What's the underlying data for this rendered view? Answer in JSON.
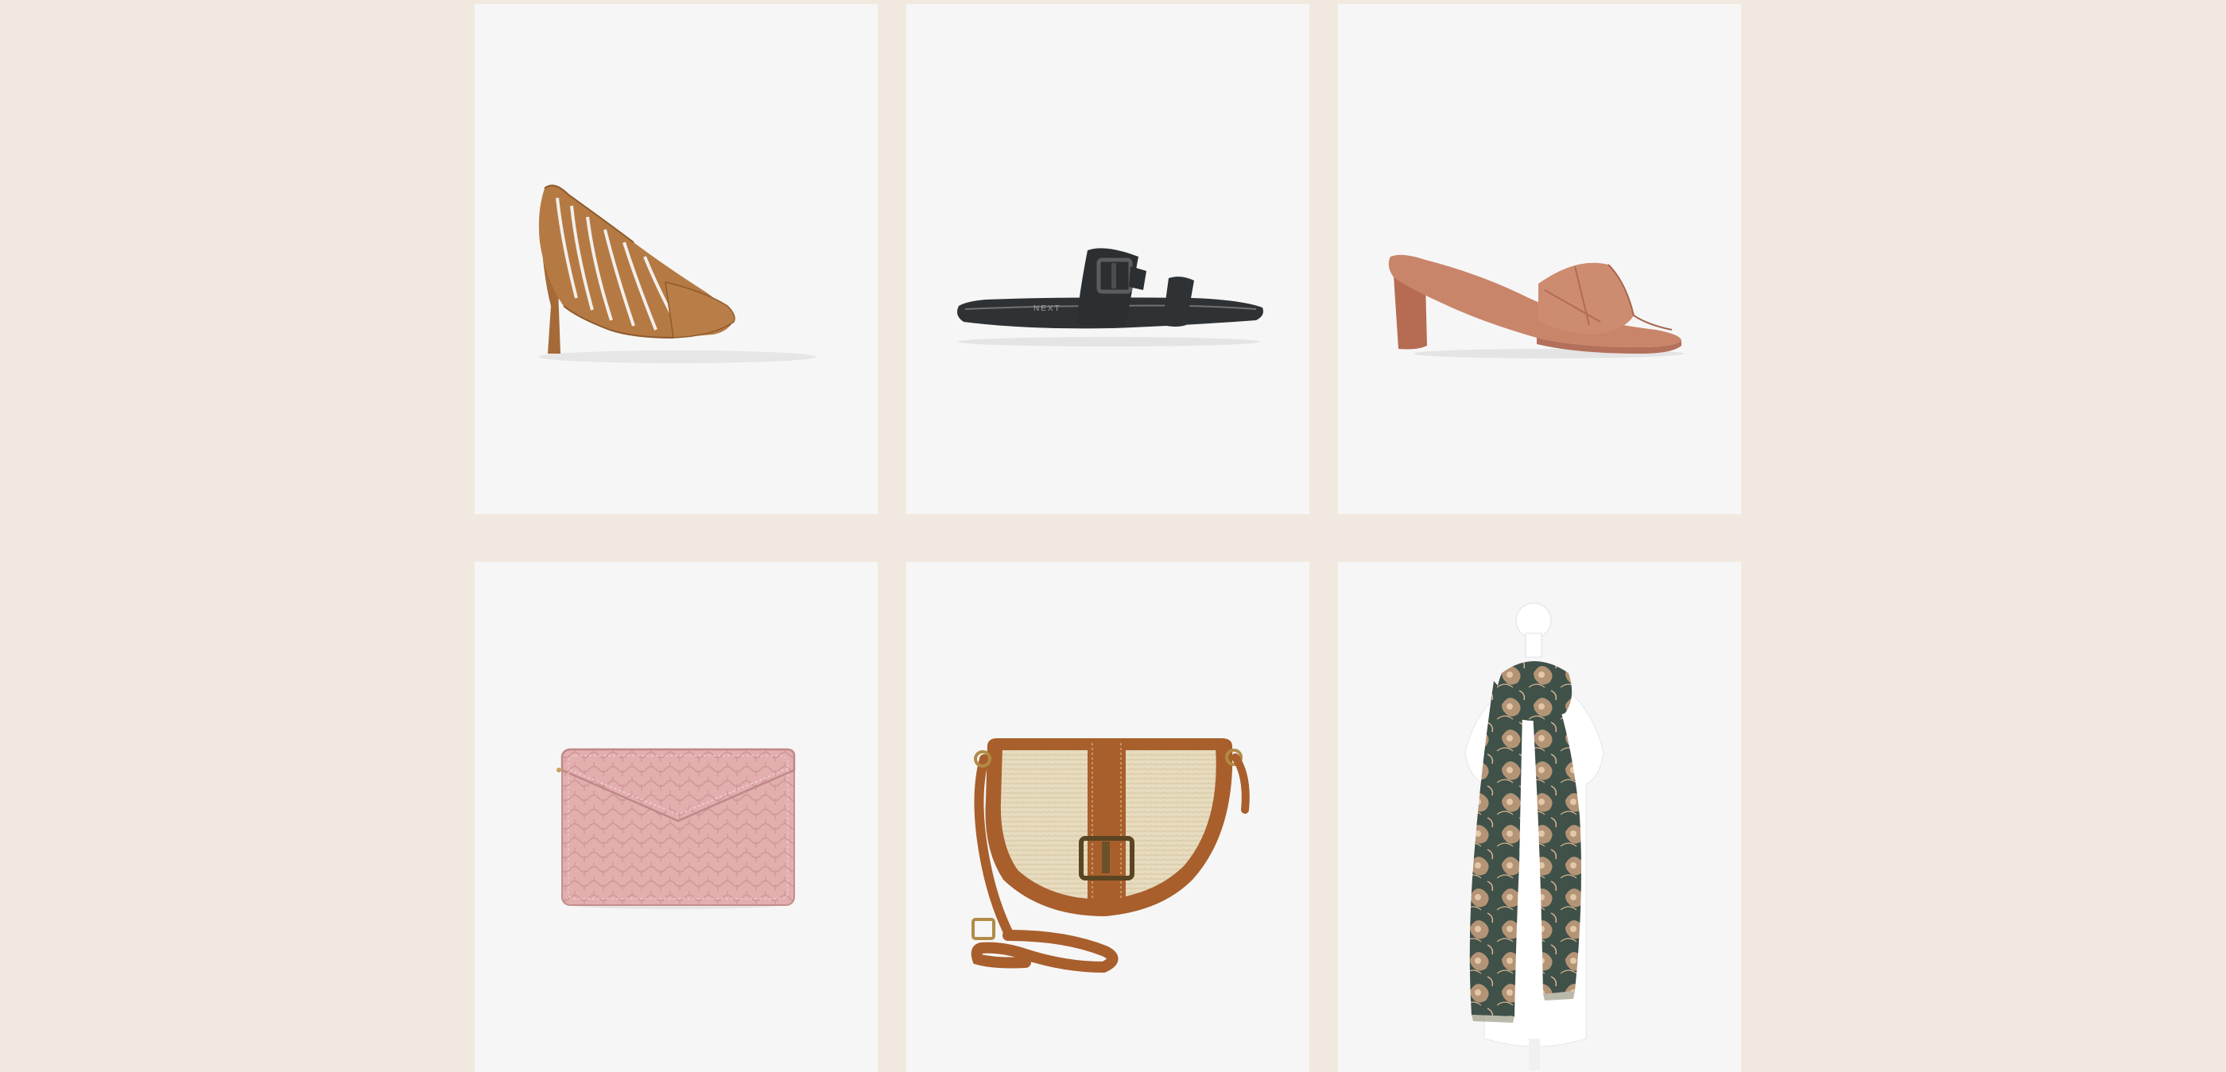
{
  "colors": {
    "page_background": "#f1e9df",
    "tile_background": "#f6f6f6",
    "tan_leather": "#b57a44",
    "black_leather": "#2f3234",
    "terracotta_leather": "#c9856a",
    "blush_croc": "#e2aeae",
    "woven_straw": "#e8dcc0",
    "scarf_green": "#3f5149",
    "scarf_beige": "#d9b592"
  },
  "products": [
    {
      "icon": "caged-stiletto-pump-image"
    },
    {
      "icon": "black-buckle-slider-sandal-image",
      "brand_mark": "NEXT"
    },
    {
      "icon": "terracotta-block-heel-mule-image"
    },
    {
      "icon": "pink-croc-envelope-purse-image"
    },
    {
      "icon": "straw-saddle-crossbody-bag-image"
    },
    {
      "icon": "floral-print-scarf-on-mannequin-image"
    }
  ]
}
